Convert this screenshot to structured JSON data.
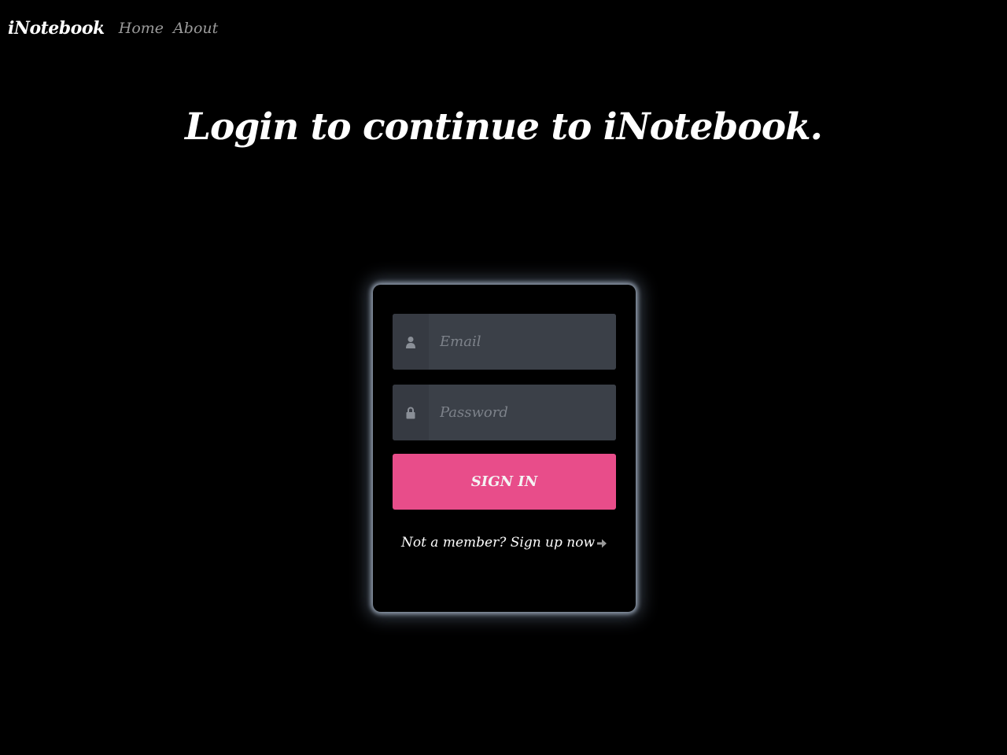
{
  "navbar": {
    "brand": "iNotebook",
    "links": [
      {
        "label": "Home"
      },
      {
        "label": "About"
      }
    ]
  },
  "main": {
    "title": "Login to continue to iNotebook."
  },
  "login_form": {
    "email": {
      "placeholder": "Email",
      "value": "",
      "icon": "user-icon"
    },
    "password": {
      "placeholder": "Password",
      "value": "",
      "icon": "lock-icon"
    },
    "signin_label": "SIGN IN",
    "signup_prompt": "Not a member?",
    "signup_link": "Sign up now",
    "signup_icon": "arrow-right-icon"
  },
  "colors": {
    "background": "#000000",
    "card_glow": "#c8d7eb",
    "input_bg": "#3b4048",
    "button": "#e84d8a",
    "nav_link": "#9a9a9a"
  }
}
